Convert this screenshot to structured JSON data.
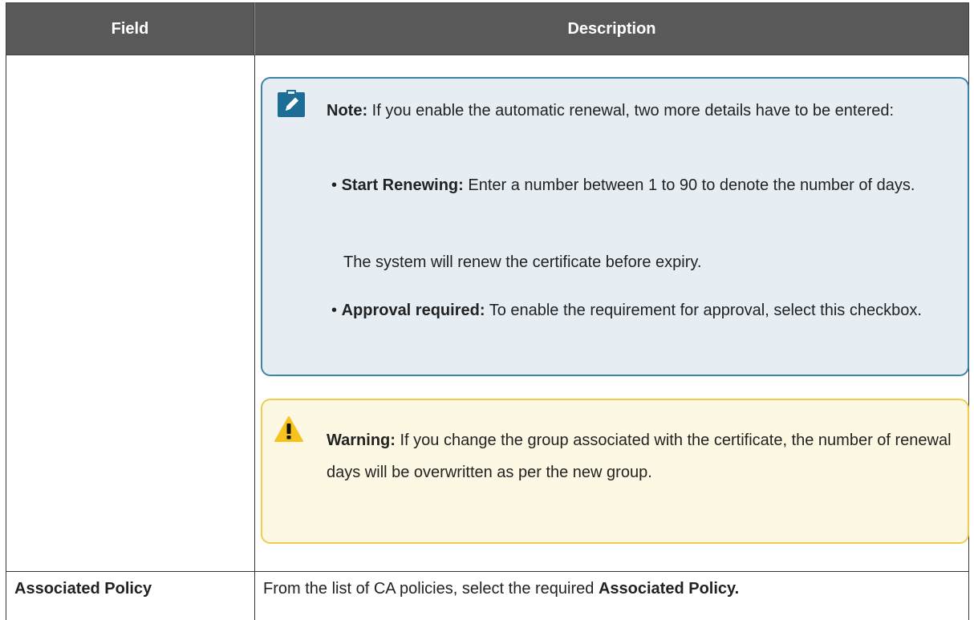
{
  "table": {
    "headers": {
      "field": "Field",
      "description": "Description"
    },
    "note": {
      "label": "Note:",
      "text": "If you enable the automatic renewal, two more details have to be entered:",
      "items": [
        {
          "label": "Start Renewing:",
          "text": "Enter a number between 1 to 90 to denote the number of days.",
          "subtext": "The system will renew the certificate before expiry."
        },
        {
          "label": "Approval required:",
          "text": "To enable the requirement for approval, select this checkbox."
        }
      ]
    },
    "warning": {
      "label": "Warning:",
      "text": "If you change the group associated with the certificate, the number of renewal days will be overwritten as per the new group."
    },
    "row2": {
      "field": "Associated Policy",
      "description_prefix": "From the list of CA policies, select the required",
      "description_bold": "Associated Policy."
    }
  },
  "colors": {
    "header_bg": "#595959",
    "note_bg": "#e6eef4",
    "note_border": "#3d82a8",
    "warning_bg": "#fdf8e4",
    "warning_border": "#f2cb4c"
  },
  "icons": {
    "note": "pencil-note-icon",
    "warning": "exclamation-triangle-icon"
  }
}
